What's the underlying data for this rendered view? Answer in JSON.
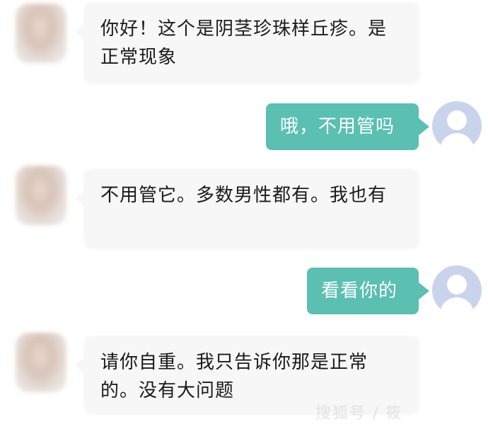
{
  "messages": [
    {
      "from": "doctor",
      "text": "你好！这个是阴茎珍珠样丘疹。是正常现象"
    },
    {
      "from": "user",
      "text": "哦，不用管吗"
    },
    {
      "from": "doctor",
      "text": "不用管它。多数男性都有。我也有"
    },
    {
      "from": "user",
      "text": "看看你的"
    },
    {
      "from": "doctor",
      "text": "请你自重。我只告诉你那是正常的。没有大问题"
    }
  ],
  "watermark": "搜狐号 / 筱",
  "colors": {
    "incoming_bubble": "#f7f7f7",
    "outgoing_bubble": "#5bbfb2",
    "user_avatar": "#c9d4ec"
  },
  "icons": {
    "doctor_avatar": "blurred-photo-avatar",
    "user_avatar": "default-user-icon"
  }
}
